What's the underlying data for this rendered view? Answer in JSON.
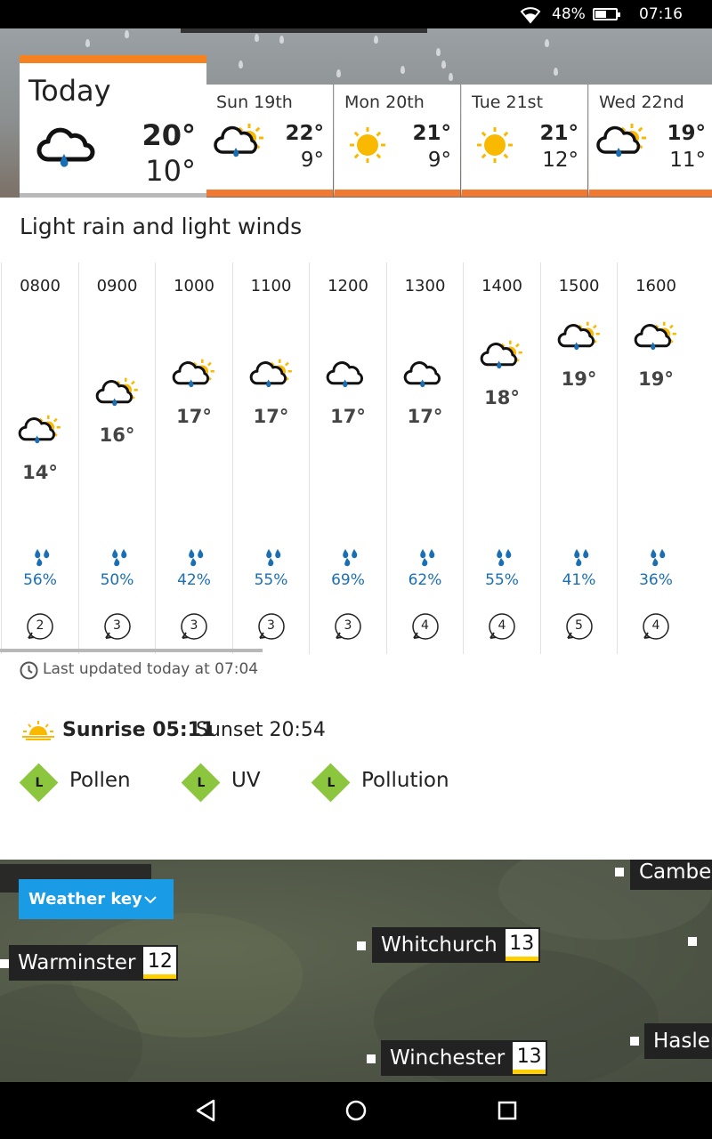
{
  "status_bar": {
    "battery": "48%",
    "time": "07:16"
  },
  "today": {
    "name": "Today",
    "high": "20°",
    "low": "10°",
    "icon": "light-rain-cloud-icon"
  },
  "days": [
    {
      "name": "Sun 19th",
      "high": "22°",
      "low": "9°",
      "icon": "sunny-intervals-rain-icon"
    },
    {
      "name": "Mon 20th",
      "high": "21°",
      "low": "9°",
      "icon": "sunny-icon"
    },
    {
      "name": "Tue 21st",
      "high": "21°",
      "low": "12°",
      "icon": "sunny-icon"
    },
    {
      "name": "Wed 22nd",
      "high": "19°",
      "low": "11°",
      "icon": "sunny-intervals-rain-icon"
    }
  ],
  "summary": "Light rain and light winds",
  "hours": [
    {
      "time": "0800",
      "temp": "14°",
      "chance": "56%",
      "wind": "2",
      "icon": "sun-rain"
    },
    {
      "time": "0900",
      "temp": "16°",
      "chance": "50%",
      "wind": "3",
      "icon": "sun-rain"
    },
    {
      "time": "1000",
      "temp": "17°",
      "chance": "42%",
      "wind": "3",
      "icon": "sun-rain"
    },
    {
      "time": "1100",
      "temp": "17°",
      "chance": "55%",
      "wind": "3",
      "icon": "sun-rain"
    },
    {
      "time": "1200",
      "temp": "17°",
      "chance": "69%",
      "wind": "3",
      "icon": "rain"
    },
    {
      "time": "1300",
      "temp": "17°",
      "chance": "62%",
      "wind": "4",
      "icon": "rain"
    },
    {
      "time": "1400",
      "temp": "18°",
      "chance": "55%",
      "wind": "4",
      "icon": "sun-rain"
    },
    {
      "time": "1500",
      "temp": "19°",
      "chance": "41%",
      "wind": "5",
      "icon": "sun-rain"
    },
    {
      "time": "1600",
      "temp": "19°",
      "chance": "36%",
      "wind": "4",
      "icon": "sun-rain"
    }
  ],
  "last_updated": "Last updated today at 07:04",
  "sun": {
    "sunrise": "Sunrise 05:11",
    "sunset": "Sunset 20:54"
  },
  "badges": [
    {
      "level": "L",
      "label": "Pollen"
    },
    {
      "level": "L",
      "label": "UV"
    },
    {
      "level": "L",
      "label": "Pollution"
    }
  ],
  "map": {
    "weather_key": "Weather key",
    "locations": [
      {
        "name": "Warminster",
        "temp": "12"
      },
      {
        "name": "Whitchurch",
        "temp": "13"
      },
      {
        "name": "Winchester",
        "temp": "13"
      },
      {
        "name": "Camber",
        "temp": ""
      },
      {
        "name": "Hasler",
        "temp": ""
      }
    ]
  },
  "colors": {
    "accent_orange": "#f58220",
    "rain_blue": "#1a6fb4",
    "sun_yellow": "#f8b900",
    "badge_green": "#8cc63f",
    "key_blue": "#1a9be6"
  }
}
